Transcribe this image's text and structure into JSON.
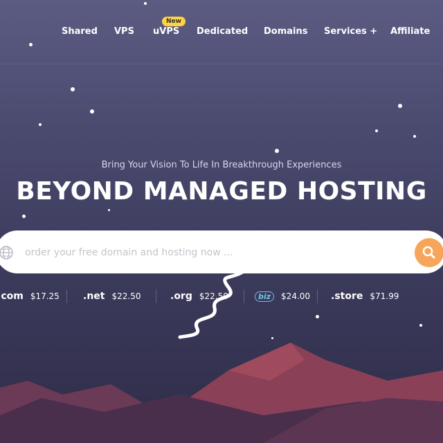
{
  "nav": {
    "items": [
      {
        "label": "Shared"
      },
      {
        "label": "VPS"
      },
      {
        "label": "uVPS",
        "badge": "New"
      },
      {
        "label": "Dedicated"
      },
      {
        "label": "Domains"
      },
      {
        "label": "Services +"
      },
      {
        "label": "Affiliate"
      }
    ]
  },
  "hero": {
    "subtitle": "Bring Your Vision To Life In Breakthrough Experiences",
    "title": "BEYOND MANAGED HOSTING"
  },
  "search": {
    "placeholder": "order your free domain and hosting now ...",
    "icon": "search-icon",
    "button_color": "#f6a55a"
  },
  "tlds": [
    {
      "name": ".com",
      "price": "$17.25"
    },
    {
      "name": ".net",
      "price": "$22.50"
    },
    {
      "name": ".org",
      "price": "$22.50"
    },
    {
      "name": "biz",
      "price": "$24.00"
    },
    {
      "name": ".store",
      "price": "$71.99"
    }
  ],
  "colors": {
    "accent": "#f6a55a",
    "badge": "#ffd23f",
    "mountain_light": "#9b4a5e",
    "mountain_dark": "#5a3350"
  }
}
